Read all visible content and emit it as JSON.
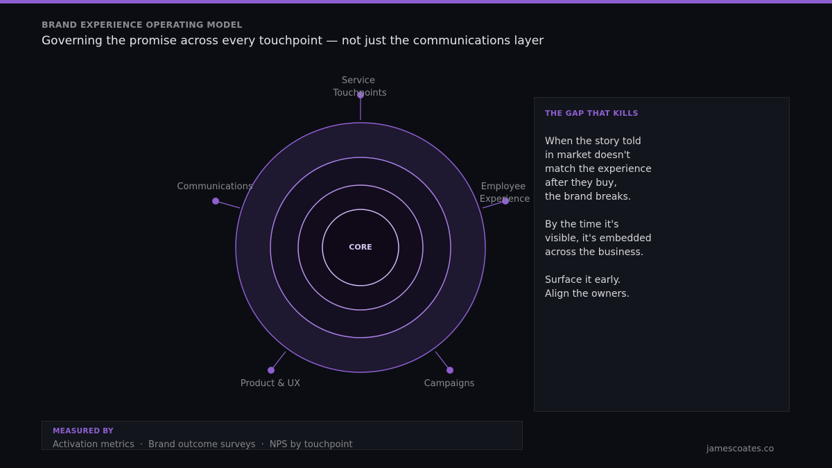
{
  "header": {
    "eyebrow": "BRAND EXPERIENCE OPERATING MODEL",
    "title": "Governing the promise across every touchpoint — not just the communications layer"
  },
  "diagram": {
    "core_label": "CORE",
    "nodes": [
      {
        "id": "service",
        "lines": [
          "Service",
          "Touchpoints"
        ]
      },
      {
        "id": "employee",
        "lines": [
          "Employee",
          "Experience"
        ]
      },
      {
        "id": "campaigns",
        "lines": [
          "Campaigns"
        ]
      },
      {
        "id": "product",
        "lines": [
          "Product & UX"
        ]
      },
      {
        "id": "communications",
        "lines": [
          "Communications"
        ]
      }
    ]
  },
  "gap_panel": {
    "title": "THE GAP THAT KILLS",
    "body": "When the story told\nin market doesn't\nmatch the experience\nafter they buy,\nthe brand breaks.\n\nBy the time it's\nvisible, it's embedded\nacross the business.\n\nSurface it early.\nAlign the owners."
  },
  "measured": {
    "title": "MEASURED BY",
    "items": [
      "Activation metrics",
      "Brand outcome surveys",
      "NPS by touchpoint"
    ],
    "separator": "·"
  },
  "footer": {
    "url": "jamescoates.co"
  },
  "colors": {
    "accent": "#8f5fd0",
    "background": "#0b0d13",
    "panel": "#12151c"
  }
}
